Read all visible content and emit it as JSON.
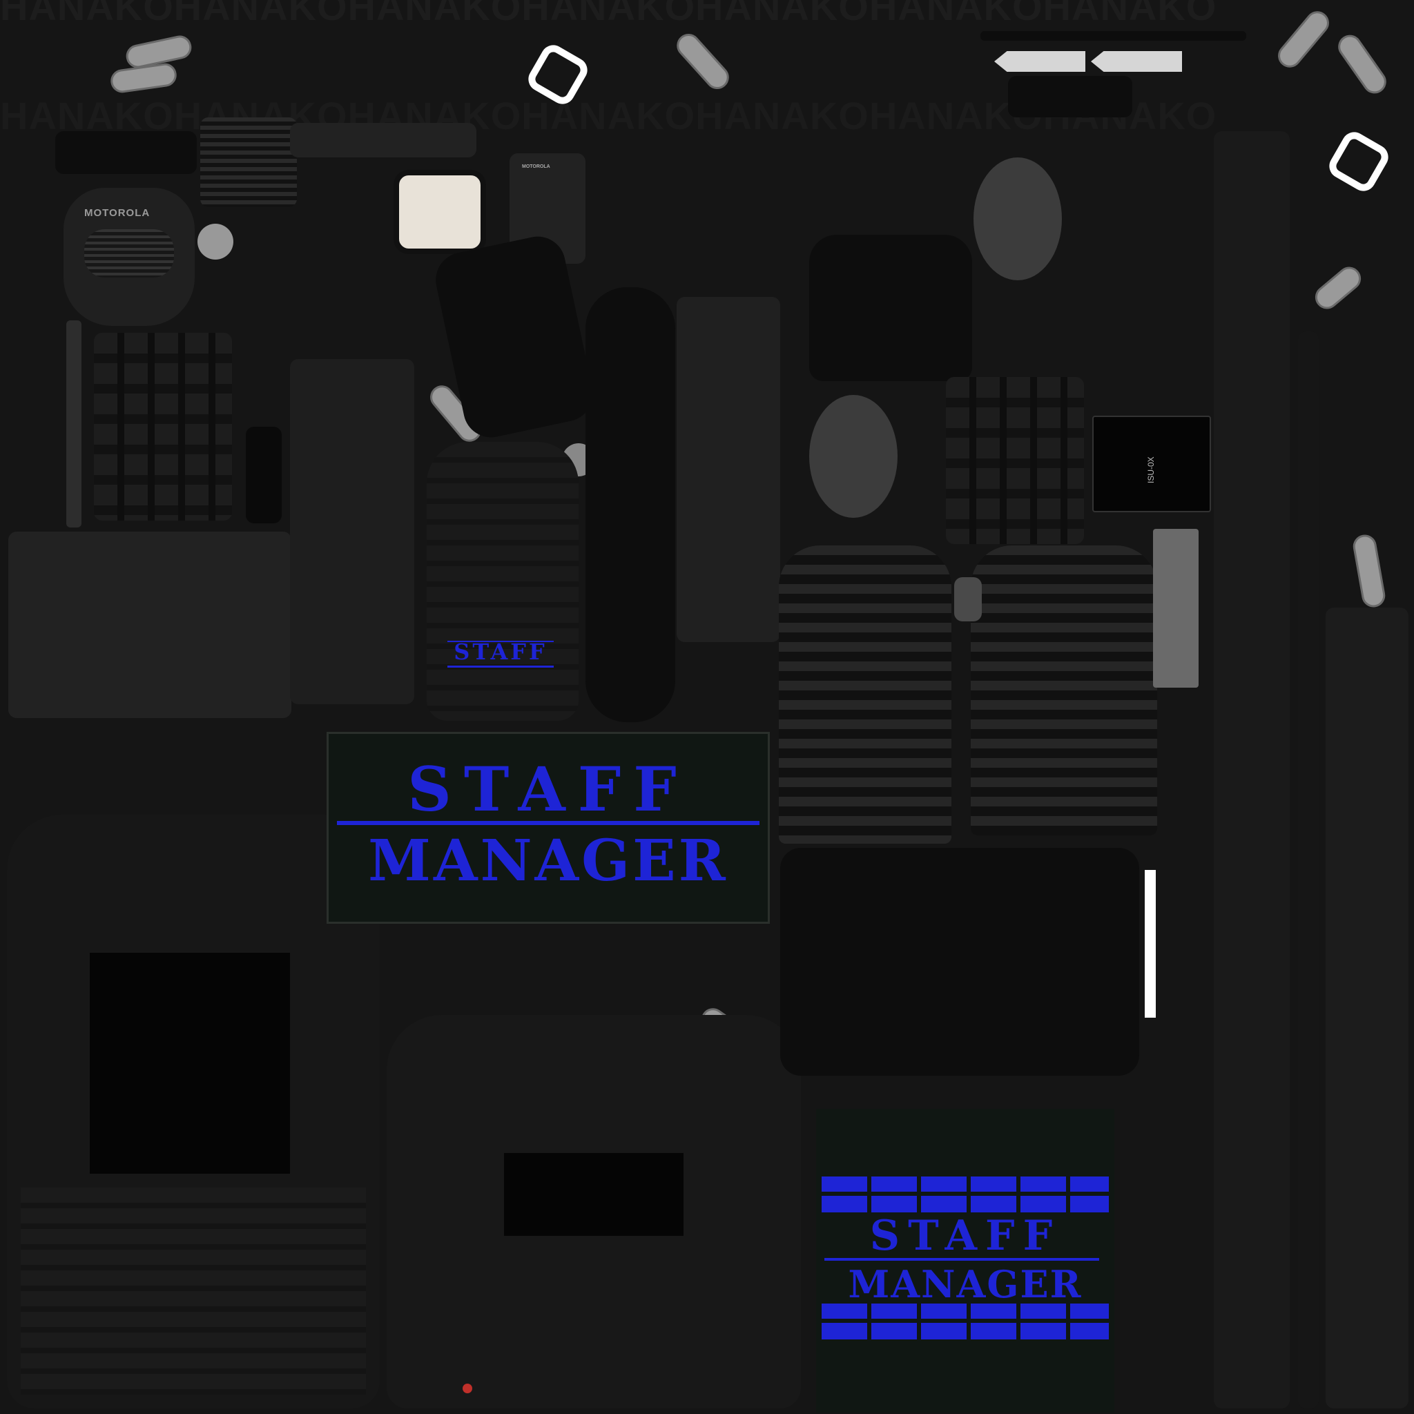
{
  "watermark": {
    "row": "HANAKOHANAKOHANAKOHANAKOHANAKOHANAKOHANAKO"
  },
  "badges": {
    "large": {
      "top": "STAFF",
      "bottom": "MANAGER"
    },
    "small": {
      "top": "STAFF",
      "bottom": "MANAGER"
    },
    "tiny": {
      "text": "STAFF"
    }
  },
  "radio": {
    "brand": "MOTOROLA",
    "brand_small": "MOTOROLA"
  },
  "device": {
    "label": "ISU-0X"
  },
  "colors": {
    "background": "#151515",
    "badge_text": "#1e24d6",
    "badge_bg": "#101713"
  }
}
